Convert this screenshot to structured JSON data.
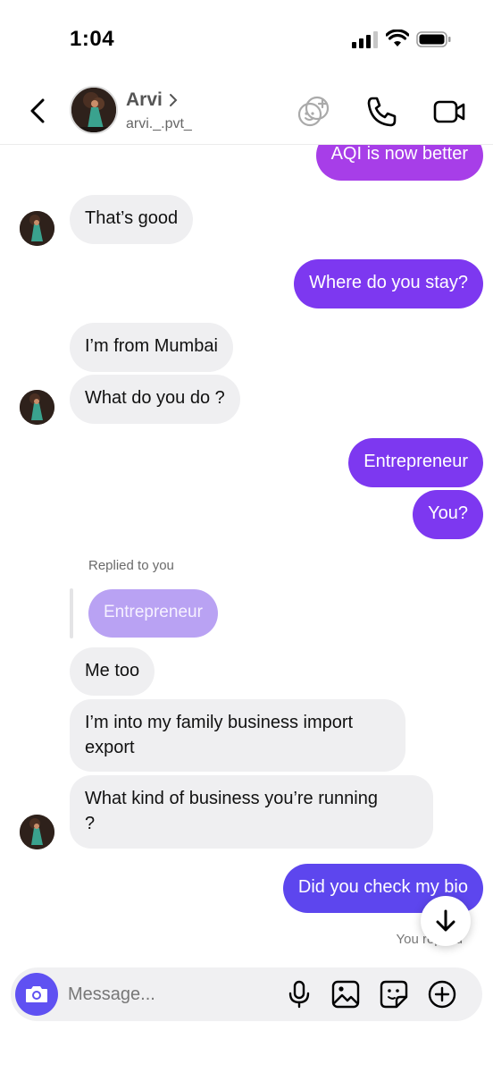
{
  "status": {
    "time": "1:04"
  },
  "header": {
    "name": "Arvi",
    "handle": "arvi._.pvt_"
  },
  "messages": {
    "m1": "AQI is now better",
    "m2": "That’s good",
    "m3": "Where do you stay?",
    "m4": "I’m from Mumbai",
    "m5": "What do you do ?",
    "m6": "Entrepreneur",
    "m7": "You?",
    "replied_label": "Replied to you",
    "reply_quote": "Entrepreneur",
    "m8": "Me too",
    "m9_line1": "I’m into my family business import",
    "m9_line2": "export",
    "m10_line1": "What kind of business you’re running",
    "m10_line2": "?",
    "m11": "Did you check my bio",
    "you_replied": "You replied"
  },
  "composer": {
    "placeholder": "Message..."
  },
  "colors": {
    "outgoing": "#7d38f0",
    "outgoing_top": "#a73ee8",
    "outgoing_bottom": "#5d46ee",
    "incoming": "#efeff1",
    "camera": "#5f51f2"
  }
}
